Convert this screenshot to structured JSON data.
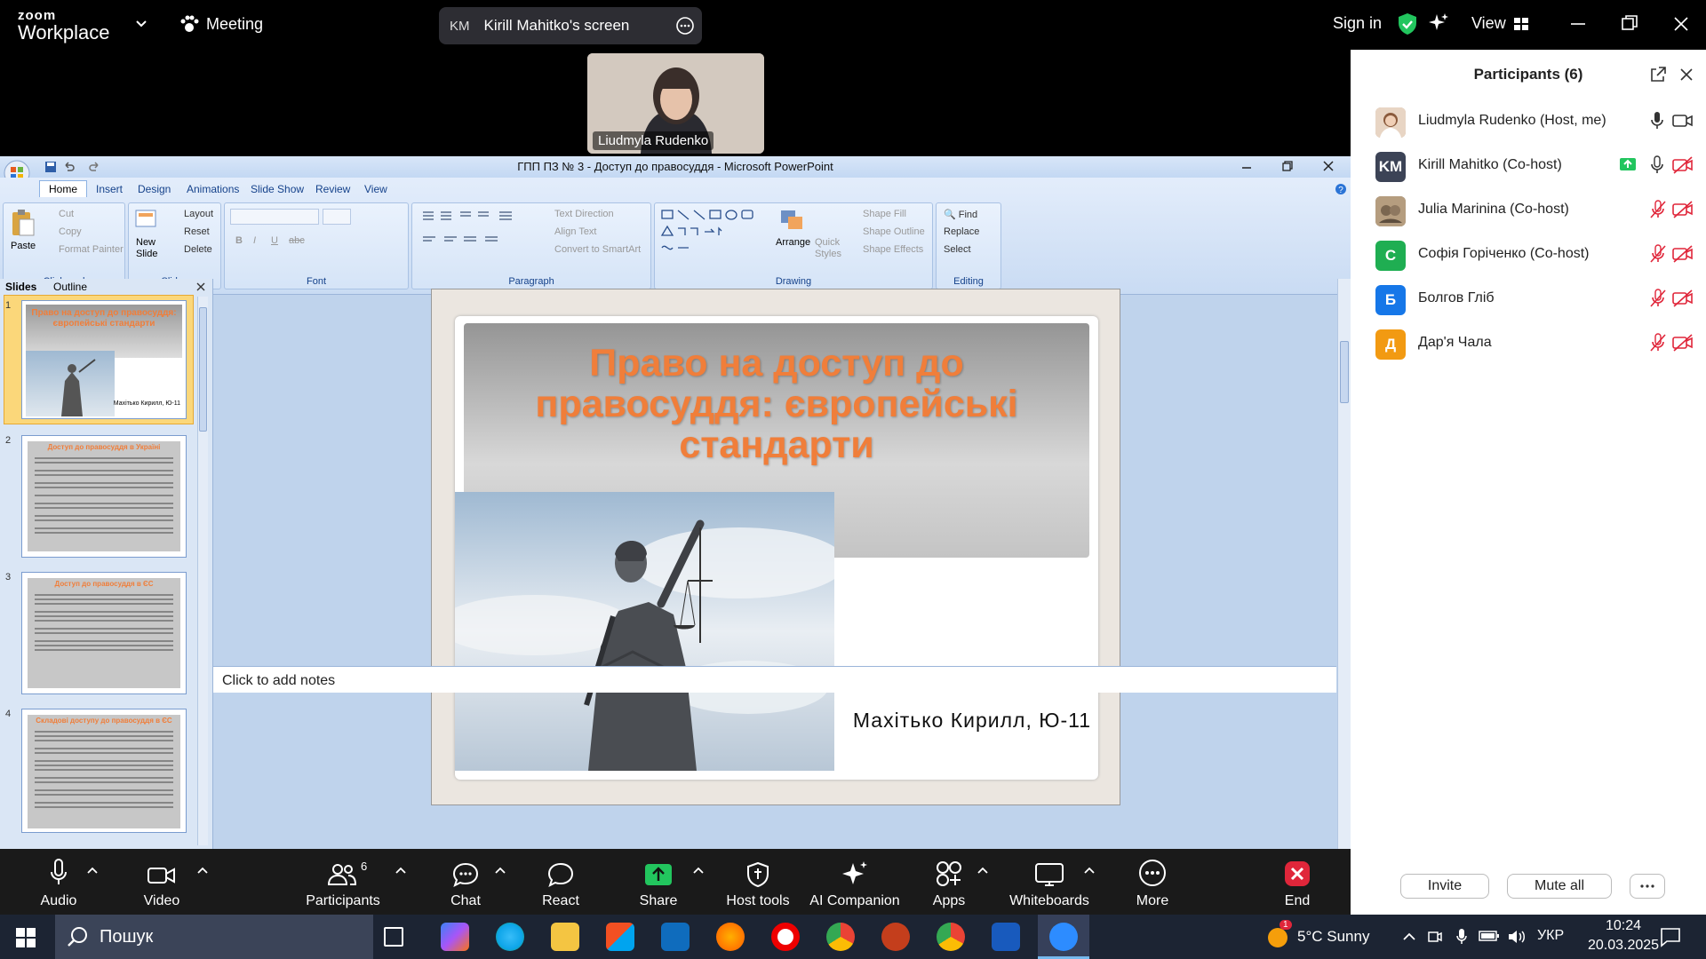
{
  "zoom": {
    "logo_top": "zoom",
    "logo_bottom": "Workplace",
    "meeting_label": "Meeting",
    "share_initials": "KM",
    "share_label": "Kirill Mahitko's screen",
    "sign_in": "Sign in",
    "view_label": "View"
  },
  "video_tile": {
    "name": "Liudmyla Rudenko"
  },
  "powerpoint": {
    "title": "ГПП ПЗ № 3 - Доступ до правосуддя - Microsoft PowerPoint",
    "tabs": [
      "Home",
      "Insert",
      "Design",
      "Animations",
      "Slide Show",
      "Review",
      "View"
    ],
    "clipboard": {
      "paste": "Paste",
      "cut": "Cut",
      "copy": "Copy",
      "format_painter": "Format Painter",
      "label": "Clipboard"
    },
    "slides_group": {
      "new_slide": "New Slide",
      "layout": "Layout",
      "reset": "Reset",
      "delete": "Delete",
      "label": "Slides"
    },
    "font_group": {
      "label": "Font"
    },
    "paragraph_group": {
      "text_direction": "Text Direction",
      "align_text": "Align Text",
      "convert": "Convert to SmartArt",
      "label": "Paragraph"
    },
    "drawing_group": {
      "arrange": "Arrange",
      "quick_styles": "Quick Styles",
      "shape_fill": "Shape Fill",
      "shape_outline": "Shape Outline",
      "shape_effects": "Shape Effects",
      "label": "Drawing"
    },
    "editing_group": {
      "find": "Find",
      "replace": "Replace",
      "select": "Select",
      "label": "Editing"
    },
    "panel_tabs": {
      "slides": "Slides",
      "outline": "Outline"
    },
    "thumbnails": [
      {
        "num": "1",
        "title": "Право на доступ до правосуддя: європейські стандарти",
        "author": "Махітько Кирилл, Ю-11"
      },
      {
        "num": "2",
        "title": "Доступ до правосуддя в Україні"
      },
      {
        "num": "3",
        "title": "Доступ до правосуддя в ЄС"
      },
      {
        "num": "4",
        "title": "Складові доступу до правосуддя в ЄС"
      }
    ],
    "slide": {
      "title": "Право на доступ до\nправосуддя: європейські\nстандарти",
      "author": "Махітько Кирилл, Ю-11"
    },
    "notes_placeholder": "Click to add notes"
  },
  "participants": {
    "header": "Participants (6)",
    "list": [
      {
        "name": "Liudmyla Rudenko (Host, me)",
        "initials": "",
        "color": "#c9a78c"
      },
      {
        "name": "Kirill Mahitko (Co-host)",
        "initials": "KM",
        "color": "#3c4356"
      },
      {
        "name": "Julia Marinina (Co-host)",
        "initials": "",
        "color": "#8a7a66"
      },
      {
        "name": "Софія Горіченко (Co-host)",
        "initials": "С",
        "color": "#1fae52"
      },
      {
        "name": "Болгов Гліб",
        "initials": "Б",
        "color": "#1677e8"
      },
      {
        "name": "Дар'я Чала",
        "initials": "Д",
        "color": "#f29a12"
      }
    ],
    "invite": "Invite",
    "mute_all": "Mute all"
  },
  "toolbar": {
    "audio": "Audio",
    "video": "Video",
    "participants": "Participants",
    "participants_count": "6",
    "chat": "Chat",
    "react": "React",
    "share": "Share",
    "host_tools": "Host tools",
    "ai_companion": "AI Companion",
    "apps": "Apps",
    "whiteboards": "Whiteboards",
    "more": "More",
    "end": "End"
  },
  "taskbar": {
    "search": "Пошук",
    "weather": "5°C Sunny",
    "lang": "УКР",
    "time": "10:24",
    "date": "20.03.2025",
    "weather_badge": "1"
  }
}
